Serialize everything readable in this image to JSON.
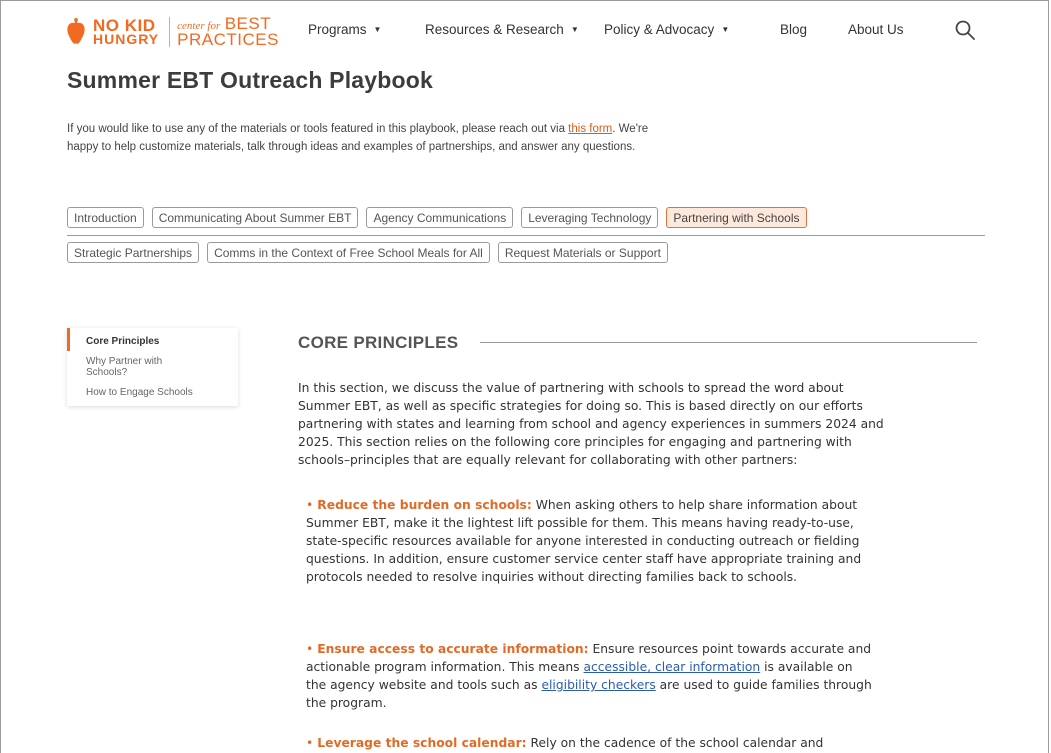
{
  "header": {
    "logo": {
      "line1_no": "NO",
      "line1_kid": "KID",
      "line2": "HUNGRY",
      "cfbp_small": "center for",
      "cfbp_best": "BEST",
      "cfbp_practices": "PRACTICES"
    },
    "nav": [
      {
        "label": "Programs",
        "dropdown": true
      },
      {
        "label": "Resources & Research",
        "dropdown": true
      },
      {
        "label": "Policy & Advocacy",
        "dropdown": true
      },
      {
        "label": "Blog",
        "dropdown": false
      },
      {
        "label": "About Us",
        "dropdown": false
      }
    ],
    "search_icon": "search-icon"
  },
  "page": {
    "title": "Summer EBT Outreach Playbook",
    "intro_before": "If you would like to use any of the materials or tools featured in this playbook, please reach out via ",
    "intro_link": "this form",
    "intro_after": ". We're happy to help customize materials, talk through ideas and examples of partnerships, and answer any questions."
  },
  "tabs": {
    "row1": [
      "Introduction",
      "Communicating About Summer EBT",
      "Agency Communications",
      "Leveraging Technology",
      "Partnering with Schools"
    ],
    "row2": [
      "Strategic Partnerships",
      "Comms in the Context of Free School Meals for All",
      "Request Materials or Support"
    ],
    "active": "Partnering with Schools"
  },
  "sidebar": {
    "items": [
      {
        "label": "Core Principles",
        "active": true
      },
      {
        "label": "Why Partner with Schools?",
        "active": false
      },
      {
        "label": "How to Engage Schools",
        "active": false
      }
    ]
  },
  "content": {
    "section_title": "CORE PRINCIPLES",
    "paragraph": "In this section, we discuss the value of partnering with schools to spread the word about Summer EBT, as well as specific strategies for doing so. This is based directly on our efforts partnering with states and learning from school and agency experiences in summers 2024 and 2025. This section relies on the following core principles for engaging and partnering with schools–principles that are equally relevant for collaborating with other partners:",
    "bullets": [
      {
        "lead": "Reduce the burden on schools:",
        "text": " When asking others to help share information about Summer EBT, make it the lightest lift possible for them. This means having ready-to-use, state-specific resources available for anyone interested in conducting outreach or fielding questions. In addition, ensure customer service center staff have appropriate training and protocols needed to resolve inquiries without directing families back to schools."
      },
      {
        "lead": "Ensure access to accurate information:",
        "text1": " Ensure resources point towards accurate and actionable program information. This means ",
        "link1": "accessible, clear information",
        "text2": " is available on the agency website and tools such as ",
        "link2": "eligibility checkers",
        "text3": " are used to guide families through the program."
      },
      {
        "lead": "Leverage the school calendar:",
        "text": " Rely on the cadence of the school calendar and"
      }
    ]
  },
  "colors": {
    "brand_orange": "#f26a21",
    "link_blue": "#2a5db0",
    "active_tab_bg": "#fde8dc"
  }
}
